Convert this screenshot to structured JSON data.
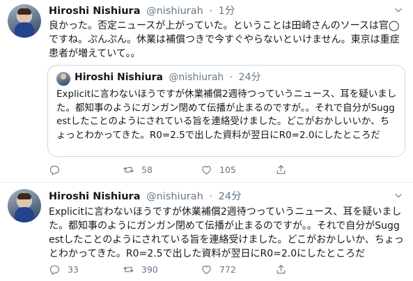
{
  "tweets": [
    {
      "name": "Hiroshi Nishiura",
      "handle": "@nishiurah",
      "dot": "·",
      "time": "1分",
      "text": "良かった。否定ニュースが上がっていた。ということは田崎さんのソースは官◯ですね。ぷんぷん。休業は補償つきで今すぐやらないといけません。東京は重症患者が増えていて。。",
      "quote": {
        "name": "Hiroshi Nishiura",
        "handle": "@nishiurah",
        "dot": "·",
        "time": "24分",
        "text": "Explicitに言わないほうですが休業補償2週待つっていうニュース、耳を疑いました。都知事のようにガンガン閉めて伝播が止まるのですが。。それで自分がSuggestしたことのようにされている旨を連絡受けました。どこがおかしいいか、ちょっとわかってきた。R0=2.5で出した資料が翌日にR0=2.0にしたところだ"
      },
      "actions": {
        "reply": "",
        "retweet": "58",
        "like": "105",
        "share": ""
      }
    },
    {
      "name": "Hiroshi Nishiura",
      "handle": "@nishiurah",
      "dot": "·",
      "time": "24分",
      "text": "Explicitに言わないほうですが休業補償2週待つっていうニュース、耳を疑いました。都知事のようにガンガン閉めて伝播が止まるのですが。。それで自分がSuggestしたことのようにされている旨を連絡受けました。どこがおかしいか、ちょっとわかってきた。R0=2.5で出した資料が翌日にR0=2.0にしたところだ",
      "actions": {
        "reply": "33",
        "retweet": "390",
        "like": "772",
        "share": ""
      }
    }
  ],
  "icons": {
    "reply": "reply-icon",
    "retweet": "retweet-icon",
    "like": "heart-icon",
    "share": "share-icon",
    "caret": "chevron-down-icon"
  },
  "colors": {
    "text": "#14171a",
    "secondary": "#657786",
    "border": "#ccd6dd"
  }
}
